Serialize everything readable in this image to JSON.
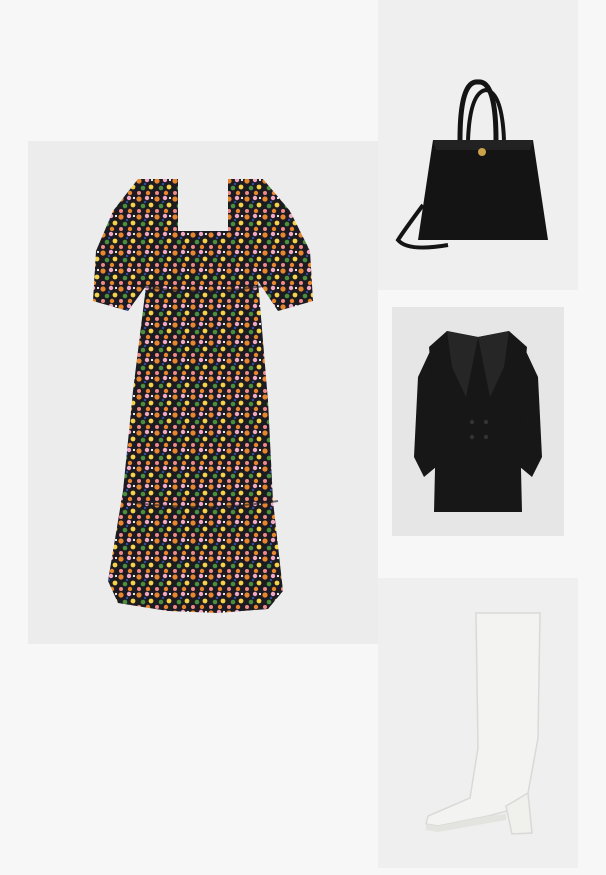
{
  "collage": {
    "items": [
      {
        "item": "floral-midi-dress",
        "colors": [
          "#1d1b22",
          "#e8862f",
          "#f2a8c4",
          "#4a8f3c",
          "#f4d24a",
          "#2d4fa0"
        ]
      },
      {
        "item": "black-tote-bag",
        "colors": [
          "#141414",
          "#c9a24a"
        ]
      },
      {
        "item": "black-blazer-dress",
        "colors": [
          "#171717"
        ]
      },
      {
        "item": "white-knee-high-boot",
        "colors": [
          "#f3f3f1",
          "#d9d9d6"
        ]
      }
    ],
    "background": "#f7f7f7"
  }
}
